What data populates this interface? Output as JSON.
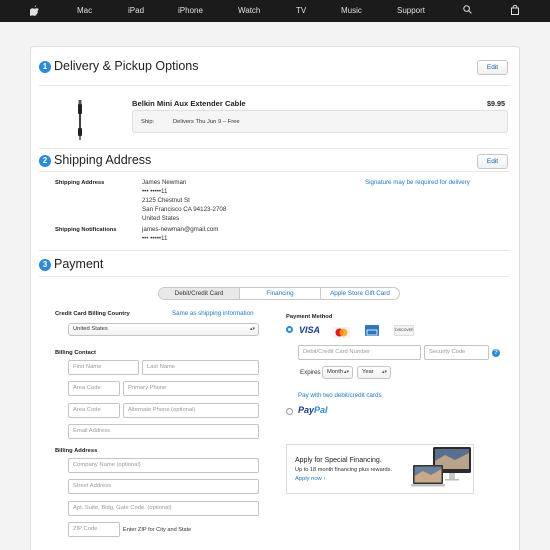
{
  "nav": {
    "items": [
      "Mac",
      "iPad",
      "iPhone",
      "Watch",
      "TV",
      "Music",
      "Support"
    ],
    "apple_icon": "apple-logo-icon",
    "search_icon": "search-icon",
    "bag_icon": "bag-icon"
  },
  "delivery": {
    "step": "1",
    "title": "Delivery & Pickup Options",
    "edit": "Edit",
    "product_name": "Belkin Mini Aux Extender Cable",
    "price": "$9.95",
    "ship_label": "Ship:",
    "ship_value": "Delivers Thu Jun 9 – Free"
  },
  "shipping": {
    "step": "2",
    "title": "Shipping Address",
    "edit": "Edit",
    "address_label": "Shipping Address",
    "address_lines": [
      "James Newman",
      "••• •••••11",
      "2125 Chestnut St",
      "San Francisco CA 94123-2708",
      "United States"
    ],
    "signature_note": "Signature may be required for delivery",
    "notifications_label": "Shipping Notifications",
    "notification_lines": [
      "james-newman@gmail.com",
      "••• •••••11"
    ]
  },
  "payment": {
    "step": "3",
    "title": "Payment",
    "tabs": [
      "Debit/Credit Card",
      "Financing",
      "Apple Store Gift Card"
    ],
    "billing_country_label": "Credit Card Billing Country",
    "same_as_shipping": "Same as shipping information",
    "country_value": "United States",
    "billing_contact_label": "Billing Contact",
    "first_name_ph": "First Name",
    "last_name_ph": "Last Name",
    "area_code_ph": "Area Code",
    "primary_phone_ph": "Primary Phone",
    "alt_phone_ph": "Alternate Phone (optional)",
    "email_ph": "Email Address",
    "billing_address_label": "Billing Address",
    "company_ph": "Company Name (optional)",
    "street_ph": "Street Address",
    "apt_ph": "Apt, Suite, Bldg, Gate Code. (optional)",
    "zip_ph": "ZIP Code",
    "zip_note": "Enter ZIP for City and State",
    "method_label": "Payment Method",
    "card_number_ph": "Debit/Credit Card Number",
    "security_code_ph": "Security Code",
    "help_icon": "?",
    "expires_label": "Expires",
    "month_value": "Month",
    "year_value": "Year",
    "two_cards_link": "Pay with two debit/credit cards",
    "card_brands": {
      "visa": "VISA",
      "discover": "DISCOVER"
    },
    "paypal_pay": "Pay",
    "paypal_pal": "Pal",
    "promo_title": "Apply for Special Financing.",
    "promo_body": "Up to 18 month financing plus rewards.",
    "promo_link": "Apply now ›"
  },
  "colors": {
    "accent": "#2a8bd6",
    "link": "#1f77c8",
    "nav": "#1b1b1b"
  }
}
